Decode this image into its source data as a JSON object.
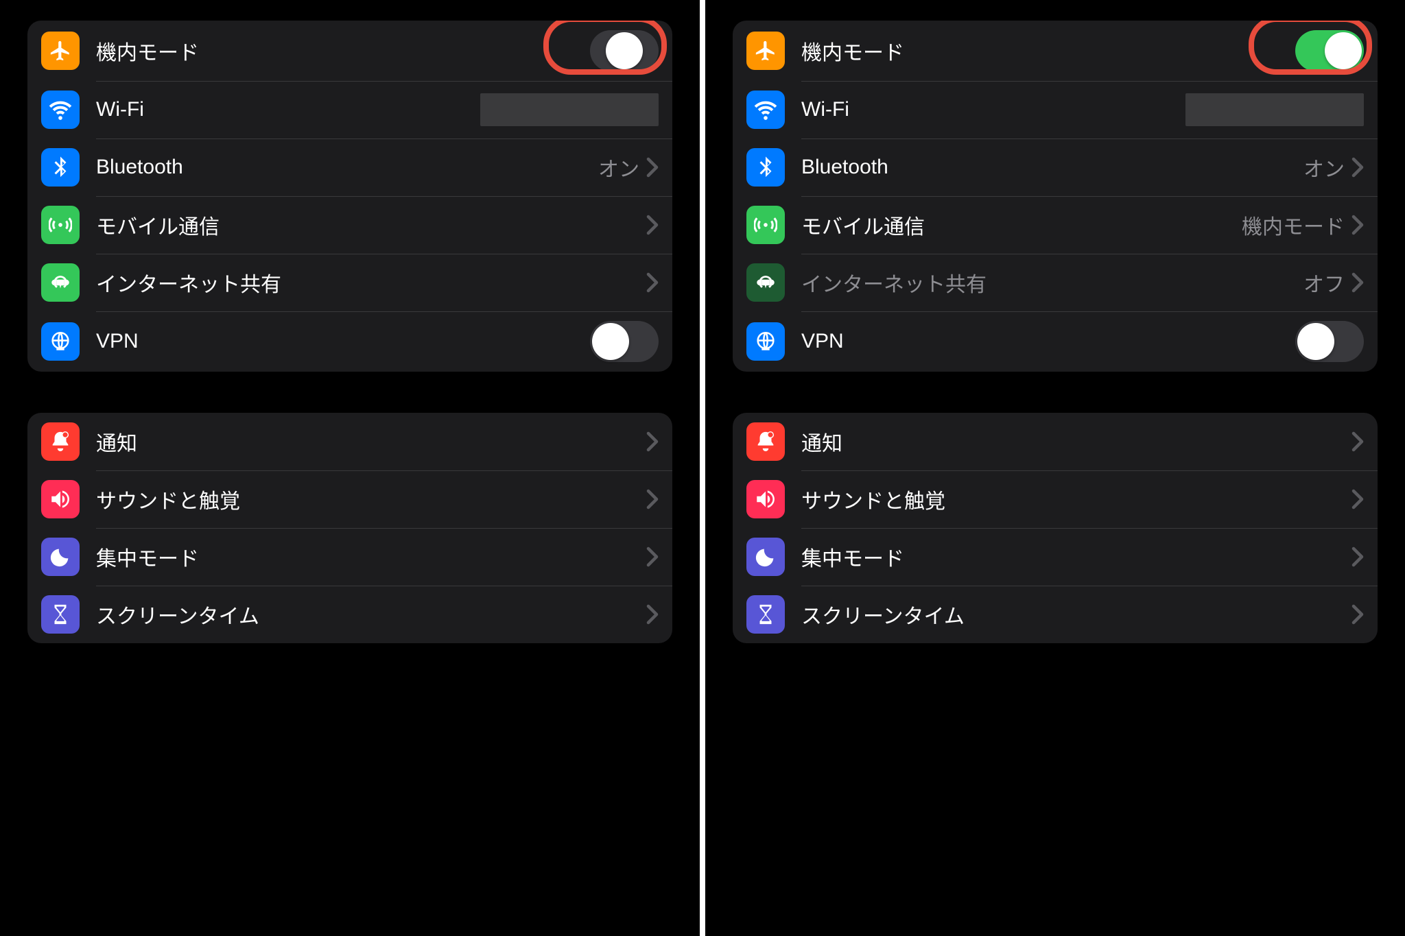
{
  "left": {
    "group1": [
      {
        "icon": "airplane",
        "bg": "bg-orange",
        "label": "機内モード",
        "type": "toggle",
        "state": "on-mid",
        "highlight": true
      },
      {
        "icon": "wifi",
        "bg": "bg-blue",
        "label": "Wi-Fi",
        "type": "wifi"
      },
      {
        "icon": "bluetooth",
        "bg": "bg-blue",
        "label": "Bluetooth",
        "type": "link",
        "value": "オン"
      },
      {
        "icon": "cellular",
        "bg": "bg-green",
        "label": "モバイル通信",
        "type": "link",
        "value": ""
      },
      {
        "icon": "hotspot",
        "bg": "bg-green",
        "label": "インターネット共有",
        "type": "link",
        "value": ""
      },
      {
        "icon": "vpn",
        "bg": "bg-blue",
        "label": "VPN",
        "type": "toggle",
        "state": "off"
      }
    ],
    "group2": [
      {
        "icon": "bell",
        "bg": "bg-red",
        "label": "通知",
        "type": "link",
        "value": ""
      },
      {
        "icon": "speaker",
        "bg": "bg-pink",
        "label": "サウンドと触覚",
        "type": "link",
        "value": ""
      },
      {
        "icon": "moon",
        "bg": "bg-indigo",
        "label": "集中モード",
        "type": "link",
        "value": ""
      },
      {
        "icon": "hourglass",
        "bg": "bg-indigo",
        "label": "スクリーンタイム",
        "type": "link",
        "value": ""
      }
    ]
  },
  "right": {
    "group1": [
      {
        "icon": "airplane",
        "bg": "bg-orange",
        "label": "機内モード",
        "type": "toggle",
        "state": "on",
        "highlight": true
      },
      {
        "icon": "wifi",
        "bg": "bg-blue",
        "label": "Wi-Fi",
        "type": "wifi"
      },
      {
        "icon": "bluetooth",
        "bg": "bg-blue",
        "label": "Bluetooth",
        "type": "link",
        "value": "オン"
      },
      {
        "icon": "cellular",
        "bg": "bg-green",
        "label": "モバイル通信",
        "type": "link",
        "value": "機内モード"
      },
      {
        "icon": "hotspot",
        "bg": "bg-green-dim",
        "label": "インターネット共有",
        "type": "link",
        "value": "オフ",
        "dim": true
      },
      {
        "icon": "vpn",
        "bg": "bg-blue",
        "label": "VPN",
        "type": "toggle",
        "state": "off"
      }
    ],
    "group2": [
      {
        "icon": "bell",
        "bg": "bg-red",
        "label": "通知",
        "type": "link",
        "value": ""
      },
      {
        "icon": "speaker",
        "bg": "bg-pink",
        "label": "サウンドと触覚",
        "type": "link",
        "value": ""
      },
      {
        "icon": "moon",
        "bg": "bg-indigo",
        "label": "集中モード",
        "type": "link",
        "value": ""
      },
      {
        "icon": "hourglass",
        "bg": "bg-indigo",
        "label": "スクリーンタイム",
        "type": "link",
        "value": ""
      }
    ]
  }
}
